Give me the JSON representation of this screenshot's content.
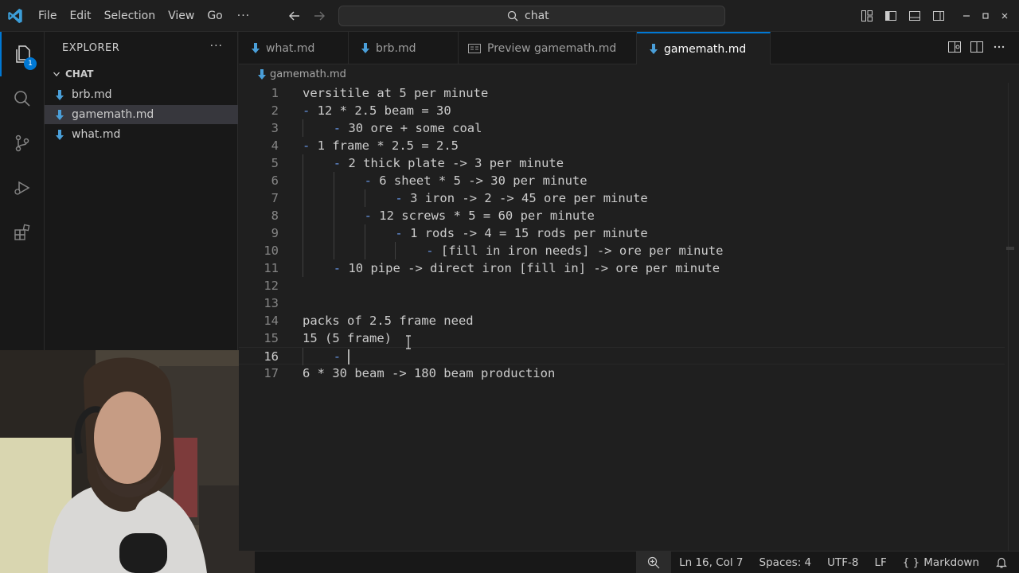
{
  "menu": {
    "items": [
      "File",
      "Edit",
      "Selection",
      "View",
      "Go"
    ],
    "more": "···"
  },
  "search": {
    "value": "chat"
  },
  "explorer": {
    "title": "EXPLORER",
    "more": "···",
    "badge": "1",
    "section": "CHAT",
    "files": [
      "brb.md",
      "gamemath.md",
      "what.md"
    ],
    "selected_index": 1
  },
  "tabs": [
    {
      "label": "what.md",
      "icon": "markdown-icon"
    },
    {
      "label": "brb.md",
      "icon": "markdown-icon"
    },
    {
      "label": "Preview gamemath.md",
      "icon": "preview-icon"
    },
    {
      "label": "gamemath.md",
      "icon": "markdown-icon",
      "active": true,
      "dirty": true
    }
  ],
  "breadcrumb": {
    "file": "gamemath.md"
  },
  "editor": {
    "lines": [
      {
        "n": "1",
        "indent": 0,
        "dash": "",
        "text": "versitile at 5 per minute"
      },
      {
        "n": "2",
        "indent": 0,
        "dash": "-",
        "text": " 12 * 2.5 beam = 30"
      },
      {
        "n": "3",
        "indent": 1,
        "dash": "-",
        "text": " 30 ore + some coal"
      },
      {
        "n": "4",
        "indent": 0,
        "dash": "-",
        "text": " 1 frame * 2.5 = 2.5"
      },
      {
        "n": "5",
        "indent": 1,
        "dash": "-",
        "text": " 2 thick plate -> 3 per minute"
      },
      {
        "n": "6",
        "indent": 2,
        "dash": "-",
        "text": " 6 sheet * 5 -> 30 per minute"
      },
      {
        "n": "7",
        "indent": 3,
        "dash": "-",
        "text": " 3 iron -> 2 -> 45 ore per minute"
      },
      {
        "n": "8",
        "indent": 2,
        "dash": "-",
        "text": " 12 screws * 5 = 60 per minute"
      },
      {
        "n": "9",
        "indent": 3,
        "dash": "-",
        "text": " 1 rods -> 4 = 15 rods per minute"
      },
      {
        "n": "10",
        "indent": 4,
        "dash": "-",
        "text": " [fill in iron needs] -> ore per minute"
      },
      {
        "n": "11",
        "indent": 1,
        "dash": "-",
        "text": " 10 pipe -> direct iron [fill in] -> ore per minute"
      },
      {
        "n": "12",
        "indent": 0,
        "dash": "",
        "text": ""
      },
      {
        "n": "13",
        "indent": 0,
        "dash": "",
        "text": ""
      },
      {
        "n": "14",
        "indent": 0,
        "dash": "",
        "text": "packs of 2.5 frame need"
      },
      {
        "n": "15",
        "indent": 0,
        "dash": "",
        "text": "15 (5 frame)"
      },
      {
        "n": "16",
        "indent": 1,
        "dash": "-",
        "text": " ",
        "current": true
      },
      {
        "n": "17",
        "indent": 0,
        "dash": "",
        "text": "6 * 30 beam -> 180 beam production"
      }
    ]
  },
  "status": {
    "position": "Ln 16, Col 7",
    "spaces": "Spaces: 4",
    "encoding": "UTF-8",
    "eol": "LF",
    "language": "Markdown"
  },
  "colors": {
    "accent": "#0078d4",
    "list_dash": "#6796e6"
  }
}
